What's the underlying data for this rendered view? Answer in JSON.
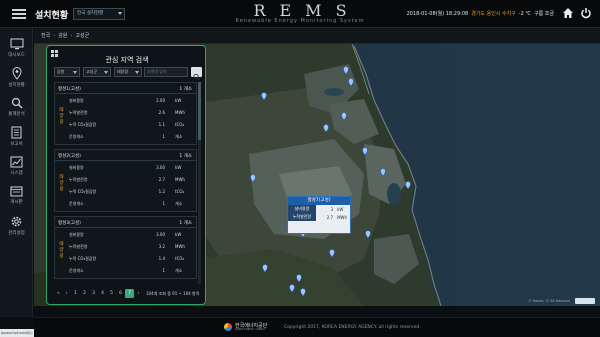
{
  "header": {
    "title": "설치현황",
    "region_select": "전국 설치현황",
    "logo": "REMS",
    "logo_subtitle": "Renewable Energy Monitoring System",
    "datetime": "2018-01-08(월) 18:29:08",
    "location": "경기도 용인시 수지구",
    "temperature": "-2 ℃",
    "weather": "구름 조금"
  },
  "sidebar": {
    "items": [
      {
        "label": "대시보드",
        "icon": "monitor-icon"
      },
      {
        "label": "설치현황",
        "icon": "map-pin-icon"
      },
      {
        "label": "통계분석",
        "icon": "magnifier-icon"
      },
      {
        "label": "보고서",
        "icon": "document-icon"
      },
      {
        "label": "시스템",
        "icon": "chart-icon"
      },
      {
        "label": "게시판",
        "icon": "board-icon"
      },
      {
        "label": "관리설정",
        "icon": "gear-icon"
      }
    ]
  },
  "breadcrumb": [
    "전국",
    "강원",
    "고성군"
  ],
  "panel": {
    "title": "관심 지역 검색",
    "filters": {
      "province": "강원",
      "city": "고성군",
      "source_type": "태양광",
      "search_placeholder": "지역명 입력"
    },
    "type_label": "태양광",
    "cards": [
      {
        "name": "평성1(고성)",
        "count_label": "1 개소",
        "rows": [
          {
            "k": "설비용량",
            "v": "2.00",
            "u": "kW"
          },
          {
            "k": "누적발전량",
            "v": "2.6",
            "u": "MWh"
          },
          {
            "k": "누적 CO₂절감량",
            "v": "1.1",
            "u": "tCO₂"
          },
          {
            "k": "운영개소",
            "v": "1",
            "u": "개소"
          }
        ]
      },
      {
        "name": "평성2(고성)",
        "count_label": "1 개소",
        "rows": [
          {
            "k": "설비용량",
            "v": "3.00",
            "u": "kW"
          },
          {
            "k": "누적발전량",
            "v": "2.7",
            "u": "MWh"
          },
          {
            "k": "누적 CO₂절감량",
            "v": "1.2",
            "u": "tCO₂"
          },
          {
            "k": "운영개소",
            "v": "1",
            "u": "개소"
          }
        ]
      },
      {
        "name": "평성3(고성)",
        "count_label": "1 개소",
        "rows": [
          {
            "k": "설비용량",
            "v": "3.00",
            "u": "kW"
          },
          {
            "k": "누적발전량",
            "v": "3.2",
            "u": "MWh"
          },
          {
            "k": "누적 CO₂절감량",
            "v": "1.4",
            "u": "tCO₂"
          },
          {
            "k": "운영개소",
            "v": "1",
            "u": "개소"
          }
        ]
      }
    ],
    "pager": {
      "first": "«",
      "prev": "‹",
      "pages": [
        "1",
        "2",
        "3",
        "4",
        "5",
        "6",
        "7"
      ],
      "active_page": "7",
      "next": "›",
      "last": "»",
      "info": "104개 조회 중 91 ~ 104 항목"
    }
  },
  "popup": {
    "title": "평성7(고성)",
    "rows": [
      {
        "k": "설비용량",
        "v": "3",
        "u": "kW"
      },
      {
        "k": "누적발전량",
        "v": "2.7",
        "u": "MWh"
      }
    ]
  },
  "map": {
    "credit": "© Kakao, © SK telecom"
  },
  "footer": {
    "org": "한국에너지공단",
    "org_sub": "KOREA ENERGY AGENCY",
    "copyright": "Copyright 2017, KOREA ENERGY AGENCY. all rights reserved."
  },
  "statusbar": "javascript:void(0);",
  "colors": {
    "accent_green": "#2ea56d",
    "location_orange": "#e1a21b",
    "popup_blue": "#1f5fa8"
  }
}
